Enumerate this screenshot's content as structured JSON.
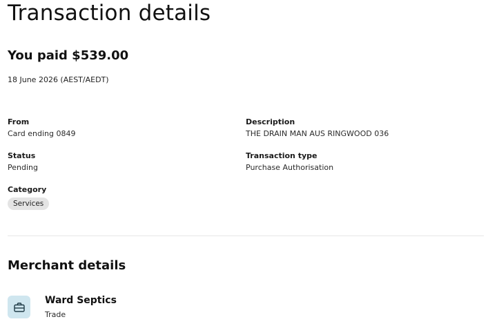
{
  "header": {
    "title": "Transaction details"
  },
  "summary": {
    "paid_text": "You paid $539.00",
    "date": "18 June 2026 (AEST/AEDT)"
  },
  "details": {
    "from": {
      "label": "From",
      "value": "Card ending 0849"
    },
    "description": {
      "label": "Description",
      "value": "THE DRAIN MAN AUS RINGWOOD 036"
    },
    "status": {
      "label": "Status",
      "value": "Pending"
    },
    "transaction_type": {
      "label": "Transaction type",
      "value": "Purchase Authorisation"
    },
    "category": {
      "label": "Category",
      "value": "Services"
    }
  },
  "merchant": {
    "section_title": "Merchant details",
    "name": "Ward Septics",
    "type": "Trade",
    "icon": "briefcase-icon",
    "icon_bg": "#cfe6ef"
  }
}
